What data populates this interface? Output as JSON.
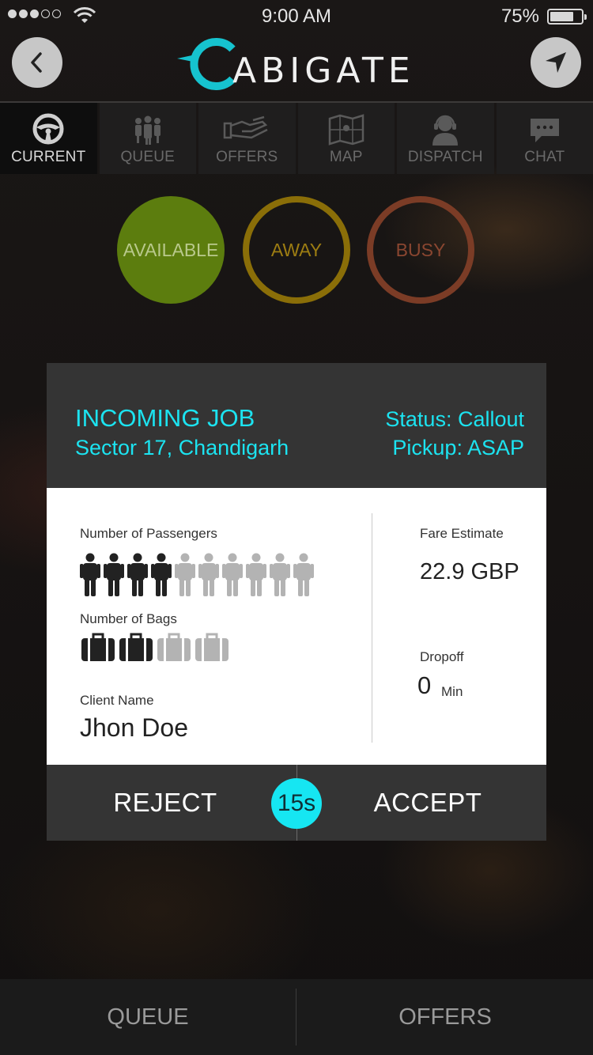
{
  "status_bar": {
    "time": "9:00 AM",
    "battery": "75%",
    "battery_level": 0.75,
    "signal_bars": 3,
    "signal_max": 5
  },
  "header": {
    "logo_text": "ABIGATE",
    "logo_letter": "C",
    "back_icon": "chevron-left-icon",
    "locate_icon": "navigation-arrow-icon"
  },
  "tabs": [
    {
      "label": "CURRENT",
      "icon": "steering-wheel-icon",
      "active": true
    },
    {
      "label": "QUEUE",
      "icon": "people-group-icon",
      "active": false
    },
    {
      "label": "OFFERS",
      "icon": "hand-offer-icon",
      "active": false
    },
    {
      "label": "MAP",
      "icon": "map-icon",
      "active": false
    },
    {
      "label": "DISPATCH",
      "icon": "operator-headset-icon",
      "active": false
    },
    {
      "label": "CHAT",
      "icon": "chat-bubble-icon",
      "active": false
    }
  ],
  "driver_status": {
    "available": "AVAILABLE",
    "away": "AWAY",
    "busy": "BUSY",
    "selected": "available"
  },
  "job": {
    "title": "INCOMING JOB",
    "location": "Sector 17, Chandigarh",
    "status": "Status: Callout",
    "pickup": "Pickup: ASAP",
    "passengers_label": "Number of Passengers",
    "passengers": 4,
    "passengers_max": 10,
    "bags_label": "Number of Bags",
    "bags": 2,
    "bags_max": 4,
    "client_label": "Client Name",
    "client_name": "Jhon Doe",
    "fare_label": "Fare Estimate",
    "fare_value": "22.9 GBP",
    "dropoff_label": "Dropoff",
    "dropoff_value": "0",
    "dropoff_unit": "Min"
  },
  "actions": {
    "reject": "REJECT",
    "accept": "ACCEPT",
    "timer": "15s"
  },
  "bottom_bar": {
    "queue": "QUEUE",
    "offers": "OFFERS"
  },
  "colors": {
    "accent": "#1ce3f0",
    "available": "#5c7d0e",
    "away": "#8a6e08",
    "busy": "#7b3c26"
  }
}
